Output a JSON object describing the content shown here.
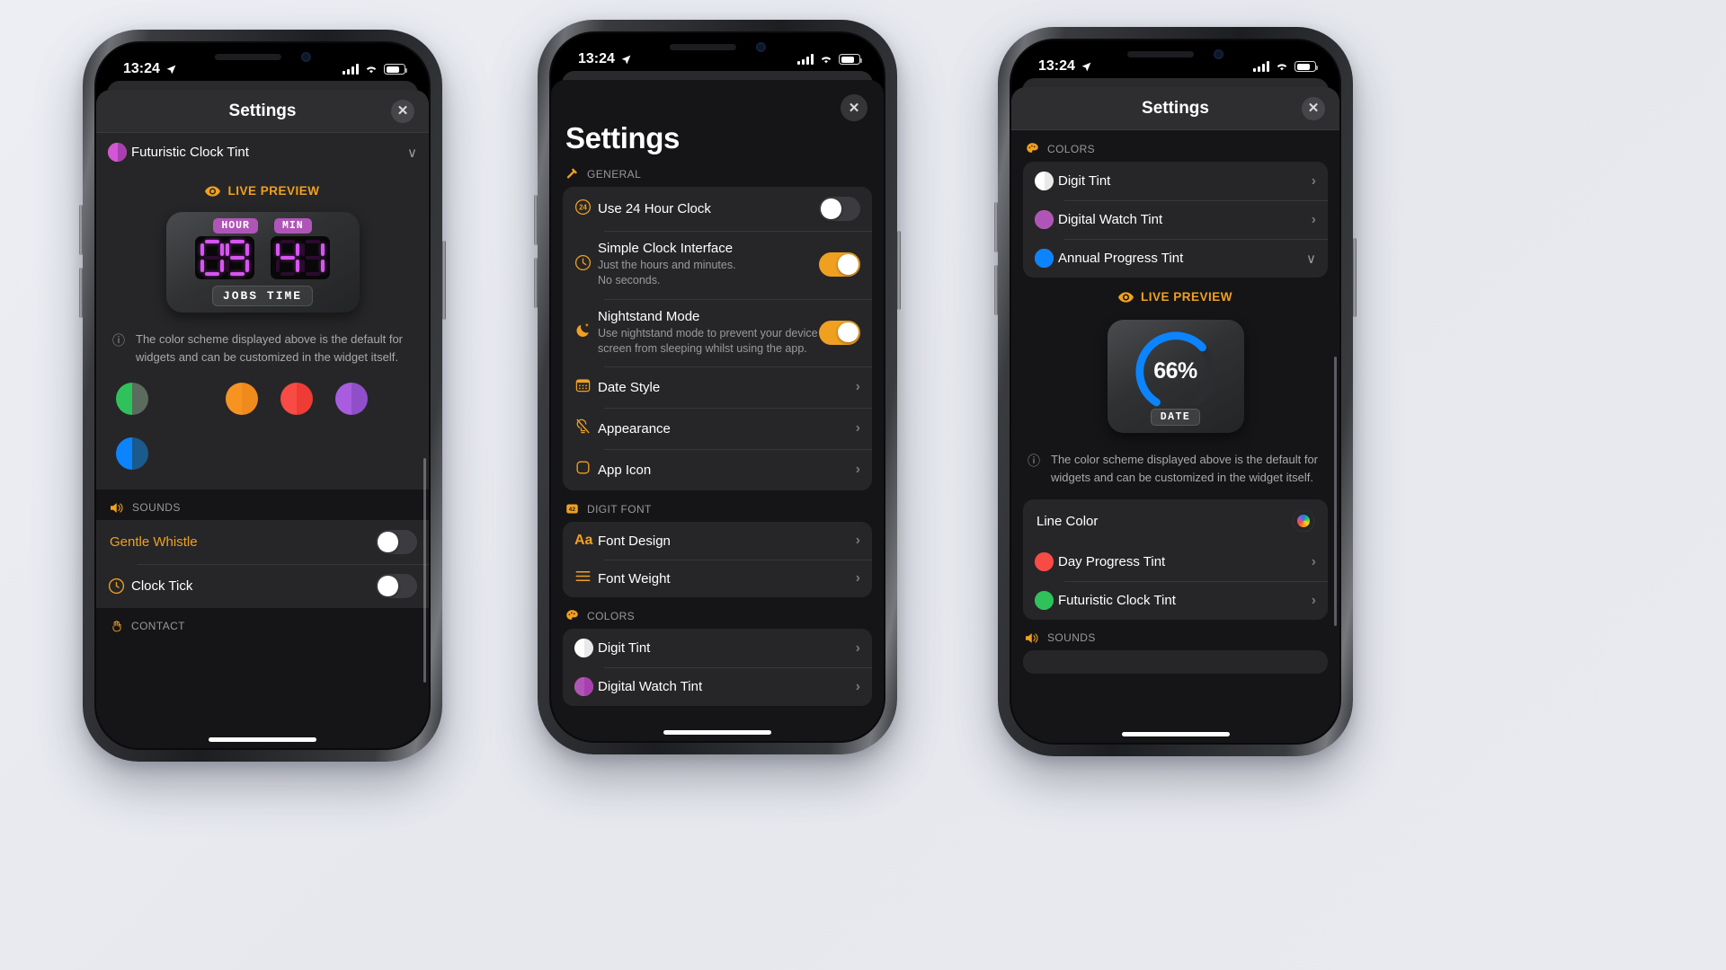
{
  "status_bar": {
    "time": "13:24",
    "location_icon": "location-arrow-icon",
    "signal_icon": "cellular-bars-icon",
    "wifi_icon": "wifi-icon",
    "battery_icon": "battery-icon"
  },
  "phone1": {
    "nav": {
      "title": "Settings",
      "close_label": "✕"
    },
    "tint_row": {
      "label": "Futuristic Clock Tint",
      "chevron": "∨",
      "swatch_left": "#f0a020",
      "swatch_right": "#b055b8"
    },
    "live_preview": {
      "label": "LIVE PREVIEW",
      "eye_icon": "eye-icon"
    },
    "widget": {
      "hour_chip": "HOUR",
      "min_chip": "MIN",
      "hour_value": "09",
      "min_value": "41",
      "badge": "JOBS TIME",
      "digit_color": "#d655f0",
      "chip_color": "#b055b8"
    },
    "info": {
      "icon": "info-circle-icon",
      "text": "The color scheme displayed above is the default for widgets and can be customized in the widget itself."
    },
    "swatches": [
      {
        "name": "green",
        "left": "#2fc25b",
        "right": "#5b6b5d"
      },
      {
        "name": "yellow",
        "left": "#ffd countries",
        "right": "#ffd countries"
      },
      {
        "name": "orange",
        "left": "#f79421",
        "right": "#ef8a1d"
      },
      {
        "name": "red",
        "left": "#f84b45",
        "right": "#ef3b35"
      },
      {
        "name": "purple",
        "left": "#a85ce0",
        "right": "#8f4fc9"
      },
      {
        "name": "blue",
        "left": "#0b84fe",
        "right": "#1b5a8c"
      }
    ],
    "sounds_header": {
      "label": "SOUNDS",
      "icon": "speaker-icon"
    },
    "sound_rows": [
      {
        "label": "Gentle Whistle",
        "accent": true,
        "toggle": "off",
        "icon": ""
      },
      {
        "label": "Clock Tick",
        "accent": false,
        "toggle": "off",
        "icon": "clock-tick-icon"
      }
    ],
    "contact_header": {
      "label": "CONTACT",
      "icon": "hand-wave-icon"
    }
  },
  "phone2": {
    "close_label": "✕",
    "page_title": "Settings",
    "sections": [
      {
        "header": {
          "label": "GENERAL",
          "icon": "hammer-icon"
        },
        "rows": [
          {
            "label": "Use 24 Hour Clock",
            "icon": "24-circle-icon",
            "control": "toggle",
            "toggle": "off"
          },
          {
            "label": "Simple Clock Interface",
            "icon": "clock-icon",
            "sub": "Just the hours and minutes.\nNo seconds.",
            "control": "toggle",
            "toggle": "on"
          },
          {
            "label": "Nightstand Mode",
            "icon": "moon-stars-icon",
            "sub": "Use nightstand mode to prevent your device screen from sleeping whilst using the app.",
            "control": "toggle",
            "toggle": "on"
          },
          {
            "label": "Date Style",
            "icon": "calendar-icon",
            "control": "chevron"
          },
          {
            "label": "Appearance",
            "icon": "lightbulb-slash-icon",
            "control": "chevron"
          },
          {
            "label": "App Icon",
            "icon": "square-icon",
            "control": "chevron"
          }
        ]
      },
      {
        "header": {
          "label": "DIGIT FONT",
          "icon": "42-badge-icon"
        },
        "rows": [
          {
            "label": "Font Design",
            "icon": "Aa",
            "control": "chevron"
          },
          {
            "label": "Font Weight",
            "icon": "lines-icon",
            "control": "chevron"
          }
        ]
      },
      {
        "header": {
          "label": "COLORS",
          "icon": "palette-icon"
        },
        "rows": [
          {
            "label": "Digit Tint",
            "icon": "swatch",
            "swatch_left": "#f0a020",
            "swatch_right": "#ffffff",
            "control": "chevron"
          },
          {
            "label": "Digital Watch Tint",
            "icon": "swatch",
            "swatch_left": "#f0a020",
            "swatch_right": "#b055b8",
            "control": "chevron"
          }
        ]
      }
    ]
  },
  "phone3": {
    "nav": {
      "title": "Settings",
      "close_label": "✕"
    },
    "colors_header": {
      "label": "COLORS",
      "icon": "palette-icon"
    },
    "color_rows": [
      {
        "label": "Digit Tint",
        "swatch_left": "#f0a020",
        "swatch_right": "#ffffff",
        "control": "chevron"
      },
      {
        "label": "Digital Watch Tint",
        "swatch_left": "#f0a020",
        "swatch_right": "#b055b8",
        "control": "chevron"
      },
      {
        "label": "Annual Progress Tint",
        "swatch_left": "#f0a020",
        "swatch_right": "#0b84fe",
        "control": "chevron-down"
      }
    ],
    "live_preview": {
      "label": "LIVE PREVIEW",
      "eye_icon": "eye-icon"
    },
    "ring_widget": {
      "percent_label": "66%",
      "percent_value": 66,
      "badge": "DATE",
      "ring_color": "#0b84fe",
      "track_color": "#2c2d30"
    },
    "info": {
      "icon": "info-circle-icon",
      "text": "The color scheme displayed above is the default for widgets and can be customized in the widget itself."
    },
    "line_color_row": {
      "label": "Line Color",
      "swatch": "rainbow-ring-icon"
    },
    "tint_rows": [
      {
        "label": "Day Progress Tint",
        "swatch_left": "#f84b45",
        "swatch_right": "#e0457f",
        "control": "chevron"
      },
      {
        "label": "Futuristic Clock Tint",
        "swatch_left": "#2fc25b",
        "swatch_right": "#b055b8",
        "control": "chevron"
      }
    ],
    "sounds_header": {
      "label": "SOUNDS",
      "icon": "speaker-icon"
    }
  }
}
